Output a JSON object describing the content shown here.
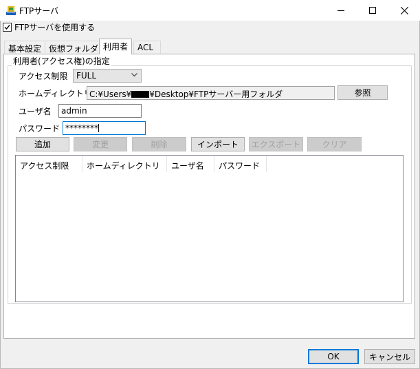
{
  "window": {
    "title": "FTPサーバ",
    "controls": {
      "minimize": "minimize-icon",
      "maximize": "maximize-icon",
      "close": "close-icon"
    }
  },
  "enable_checkbox": {
    "label": "FTPサーバを使用する",
    "checked": true
  },
  "tabs": [
    {
      "label": "基本設定",
      "active": false
    },
    {
      "label": "仮想フォルダ",
      "active": false
    },
    {
      "label": "利用者",
      "active": true
    },
    {
      "label": "ACL",
      "active": false
    }
  ],
  "user_group": {
    "title": "利用者(アクセス権)の指定",
    "access_label": "アクセス制限",
    "access_value": "FULL",
    "home_label": "ホームディレクトリ",
    "home_prefix": "C:¥Users¥",
    "home_suffix": "¥Desktop¥FTPサーバー用フォルダ",
    "browse_button": "参照",
    "user_label": "ユーザ名",
    "user_value": "admin",
    "password_label": "パスワード",
    "password_value": "********"
  },
  "actions": [
    {
      "label": "追加",
      "enabled": true
    },
    {
      "label": "変更",
      "enabled": false
    },
    {
      "label": "削除",
      "enabled": false
    },
    {
      "label": "インポート",
      "enabled": true
    },
    {
      "label": "エクスポート",
      "enabled": false
    },
    {
      "label": "クリア",
      "enabled": false
    }
  ],
  "list_columns": [
    "アクセス制限",
    "ホームディレクトリ",
    "ユーザ名",
    "パスワード"
  ],
  "list_rows": [],
  "footer": {
    "ok": "OK",
    "cancel": "キャンセル"
  },
  "colors": {
    "accent": "#0078d7",
    "window_bg": "#f0f0f0",
    "panel_bg": "#ffffff"
  }
}
